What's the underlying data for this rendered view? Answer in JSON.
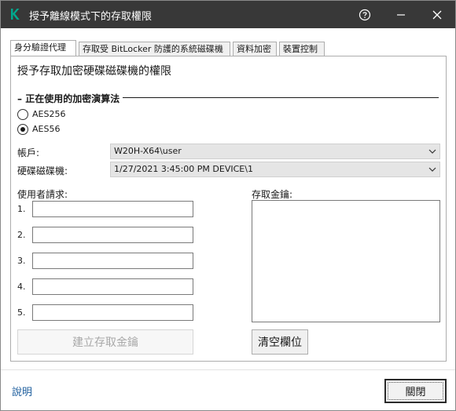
{
  "window": {
    "title": "授予離線模式下的存取權限",
    "accent_color": "#00a88e",
    "titlebar_color": "#383838"
  },
  "tabs": [
    {
      "label": "身分驗證代理",
      "active": true
    },
    {
      "label": "存取受 BitLocker 防護的系統磁碟機",
      "active": false
    },
    {
      "label": "資料加密",
      "active": false
    },
    {
      "label": "裝置控制",
      "active": false
    }
  ],
  "main": {
    "heading": "授予存取加密硬碟磁碟機的權限",
    "algorithm_group": "正在使用的加密演算法",
    "algorithms": [
      {
        "label": "AES256",
        "checked": false
      },
      {
        "label": "AES56",
        "checked": true
      }
    ],
    "account_label": "帳戶:",
    "account_value": "W20H-X64\\user",
    "drive_label": "硬碟磁碟機:",
    "drive_value": "1/27/2021 3:45:00 PM  DEVICE\\1",
    "user_request_label": "使用者請求:",
    "request_numbers": [
      "1.",
      "2.",
      "3.",
      "4.",
      "5."
    ],
    "request_values": [
      "",
      "",
      "",
      "",
      ""
    ],
    "access_key_label": "存取金鑰:",
    "access_key_value": "",
    "create_key_button": "建立存取金鑰",
    "clear_button": "清空欄位"
  },
  "footer": {
    "help_link": "說明",
    "close_button": "關閉"
  }
}
